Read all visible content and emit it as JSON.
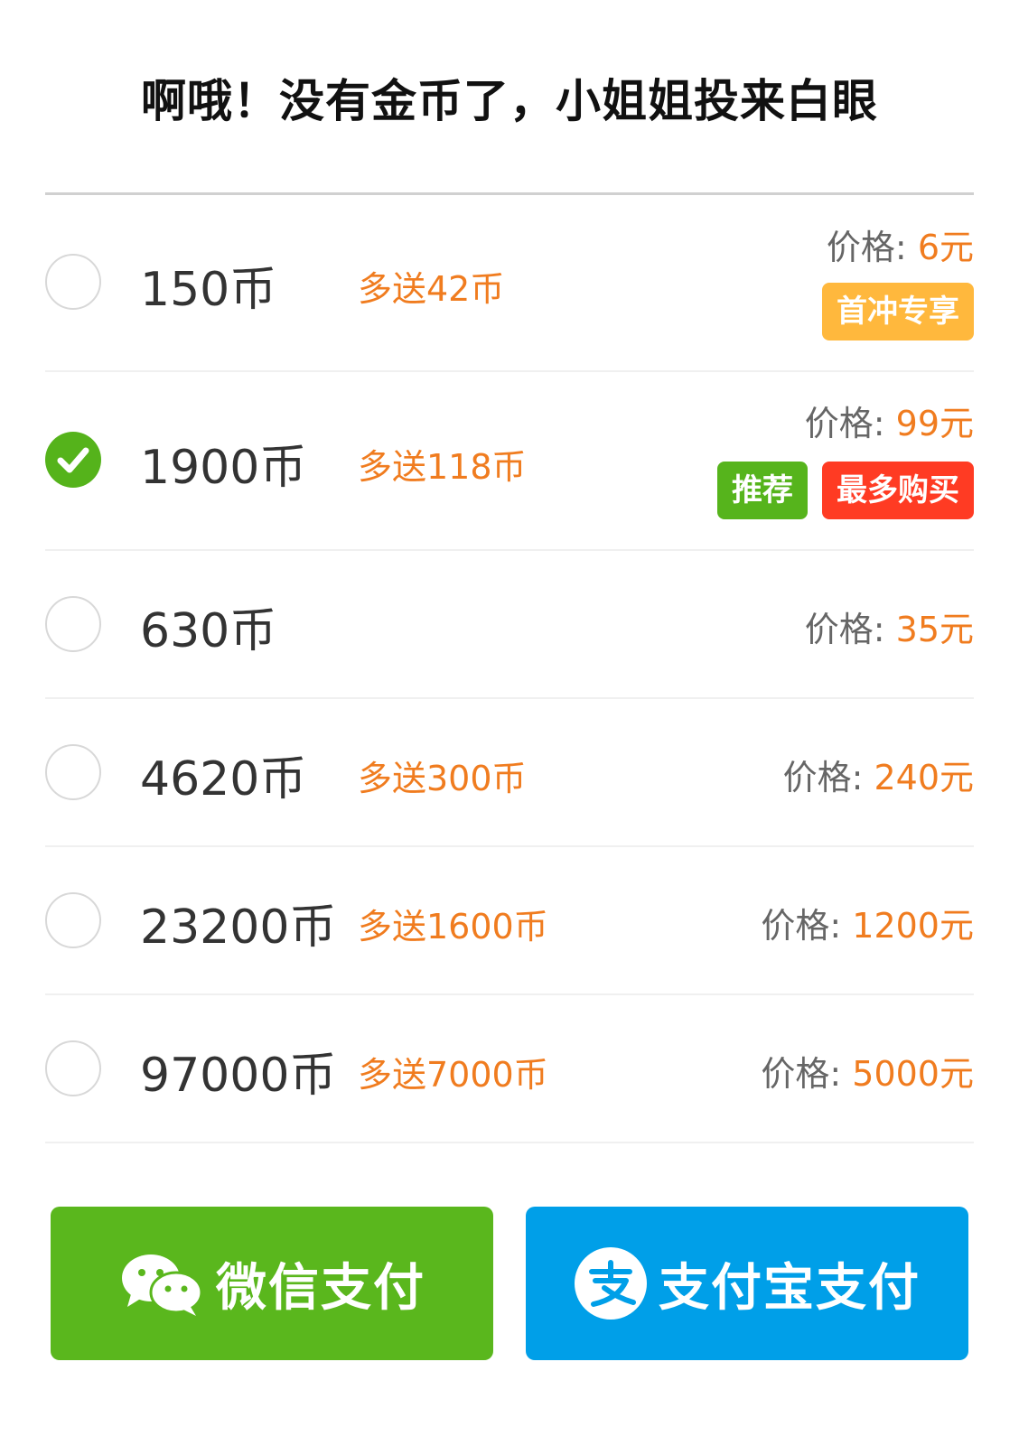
{
  "title": "啊哦！没有金币了，小姐姐投来白眼",
  "price_label": "价格: ",
  "options": [
    {
      "coins": "150币",
      "bonus": "多送42币",
      "price": "6元",
      "selected": false,
      "badges": [
        {
          "text": "首冲专享",
          "color": "#ffb83d"
        }
      ]
    },
    {
      "coins": "1900币",
      "bonus": "多送118币",
      "price": "99元",
      "selected": true,
      "badges": [
        {
          "text": "推荐",
          "color": "#56b41c"
        },
        {
          "text": "最多购买",
          "color": "#ff3b23"
        }
      ]
    },
    {
      "coins": "630币",
      "bonus": "",
      "price": "35元",
      "selected": false,
      "badges": []
    },
    {
      "coins": "4620币",
      "bonus": "多送300币",
      "price": "240元",
      "selected": false,
      "badges": []
    },
    {
      "coins": "23200币",
      "bonus": "多送1600币",
      "price": "1200元",
      "selected": false,
      "badges": []
    },
    {
      "coins": "97000币",
      "bonus": "多送7000币",
      "price": "5000元",
      "selected": false,
      "badges": []
    }
  ],
  "payment": {
    "wechat": {
      "label": "微信支付",
      "icon": "wechat-icon",
      "color": "#5ab71d"
    },
    "alipay": {
      "label": "支付宝支付",
      "icon": "alipay-icon",
      "color": "#009fe8"
    }
  },
  "colors": {
    "accent_orange": "#f07c1f",
    "check_green": "#55b31b"
  }
}
